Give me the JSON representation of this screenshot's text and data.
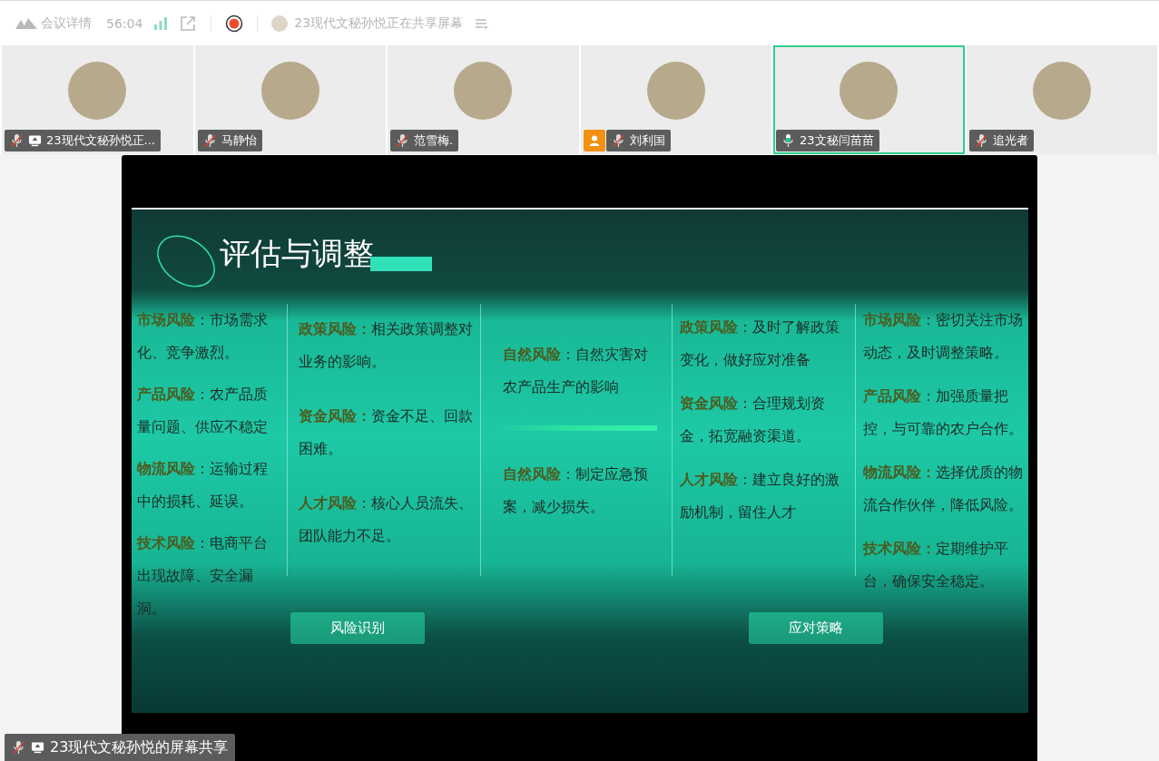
{
  "toolbar": {
    "meeting_details": "会议详情",
    "timer": "56:04",
    "share_notice": "23现代文秘孙悦正在共享屏幕"
  },
  "participants": [
    {
      "name": "23现代文秘孙悦正...",
      "muted": true,
      "sharing": true,
      "host": false,
      "selected": false
    },
    {
      "name": "马静怡",
      "muted": true,
      "sharing": false,
      "host": false,
      "selected": false
    },
    {
      "name": "范雪梅.",
      "muted": true,
      "sharing": false,
      "host": false,
      "selected": false
    },
    {
      "name": "刘利国",
      "muted": true,
      "sharing": false,
      "host": true,
      "selected": false
    },
    {
      "name": "23文秘闫苗苗",
      "muted": false,
      "sharing": false,
      "host": false,
      "selected": true
    },
    {
      "name": "追光者",
      "muted": true,
      "sharing": false,
      "host": false,
      "selected": false
    }
  ],
  "slide": {
    "title": "评估与调整",
    "columns": [
      {
        "items": [
          "**市场风险**：市场需求化、竞争激烈。",
          "**产品风险**：农产品质量问题、供应不稳定",
          "**物流风险**：运输过程中的损耗、延误。",
          "**技术风险**：电商平台出现故障、安全漏洞。"
        ]
      },
      {
        "items": [
          "**政策风险：**相关政策调整对业务的影响。",
          "**资金风险：**资金不足、回款困难。",
          "**人才风险**：核心人员流失、团队能力不足。"
        ]
      },
      {
        "items": [
          "**自然风险**：自然灾害对农产品生产的影响",
          "**自然风险**：制定应急预案，减少损失。"
        ]
      },
      {
        "items": [
          "**政策风险**：及时了解政策变化，做好应对准备",
          "**资金风险**：合理规划资金，拓宽融资渠道。",
          "**人才风险**：建立良好的激励机制，留住人才"
        ]
      },
      {
        "items": [
          "**市场风险**：密切关注市场动态，及时调整策略。",
          "**产品风险**：加强质量把控，与可靠的农户合作。",
          "**物流风险：**选择优质的物流合作伙伴，降低风险。",
          "**技术风险：**定期维护平台，确保安全稳定。"
        ]
      }
    ],
    "stage_labels": [
      "风险识别",
      "应对策略"
    ]
  },
  "share_label": {
    "text": "23现代文秘孙悦的屏幕共享",
    "muted": true,
    "sharing": true
  }
}
